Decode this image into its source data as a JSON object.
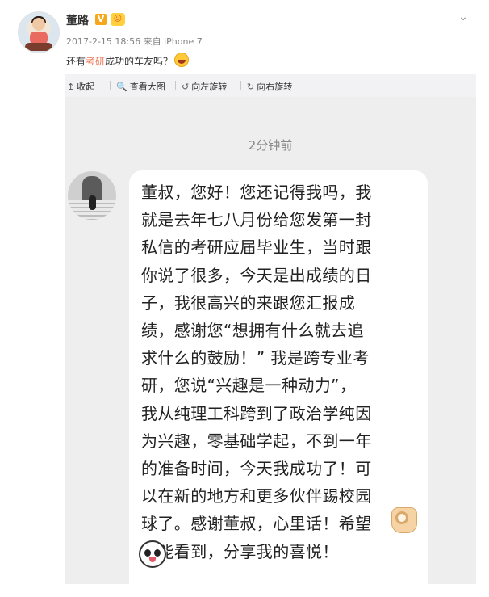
{
  "post": {
    "username": "董路",
    "verified_badge": "V",
    "meta": "2017-2-15 18:56 来自 iPhone 7",
    "text_before": "还有",
    "text_highlight": "考研",
    "text_after": "成功的车友吗？",
    "emoji": "laughing-emoji",
    "menu_icon": "chevron-down-icon"
  },
  "toolbar": {
    "items": [
      {
        "icon": "↥",
        "label": "收起"
      },
      {
        "icon": "🔍",
        "label": "查看大图"
      },
      {
        "icon": "↺",
        "label": "向左旋转"
      },
      {
        "icon": "↻",
        "label": "向右旋转"
      }
    ]
  },
  "chat": {
    "timestamp": "2分钟前",
    "message": "董叔，您好！您还记得我吗，我\n就是去年七八月份给您发第一封\n私信的考研应届毕业生，当时跟\n你说了很多，今天是出成绩的日\n子，我很高兴的来跟您汇报成\n绩，感谢您“想拥有什么就去追\n求什么的鼓励！” 我是跨专业考\n研，您说“兴趣是一种动力”，\n我从纯理工科跨到了政治学纯因\n为兴趣，零基础学起，不到一年\n的准备时间，今天我成功了！可\n以在新的地方和更多伙伴踢校园\n球了。感谢董叔，心里话！希望\n您能看到，分享我的喜悦！",
    "emojis": [
      "ok-hand-icon",
      "panda-icon"
    ]
  },
  "colors": {
    "highlight": "#eb7350",
    "panel_bg": "#f2f2f5",
    "bubble_bg": "#ffffff"
  }
}
